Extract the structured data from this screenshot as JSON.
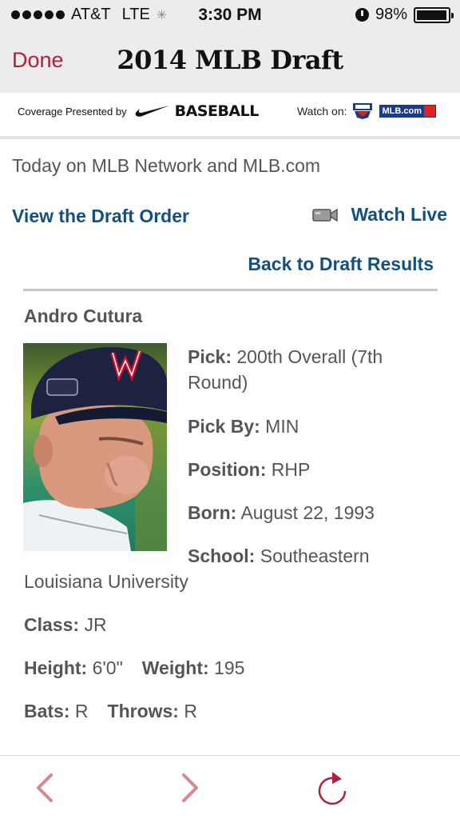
{
  "status_bar": {
    "carrier": "AT&T",
    "network": "LTE",
    "time": "3:30 PM",
    "battery": "98%",
    "battery_level": 0.98
  },
  "nav": {
    "done_label": "Done",
    "title": "2014 MLB Draft"
  },
  "sponsor": {
    "coverage_text": "Coverage Presented by",
    "brand_text": "BASEBALL",
    "watch_on": "Watch on:",
    "mlbcom": "MLB.com"
  },
  "main": {
    "today_text": "Today on MLB Network and MLB.com",
    "view_draft_order": "View the Draft Order",
    "watch_live": "Watch Live",
    "back_to_results": "Back to Draft Results"
  },
  "player": {
    "name": "Andro Cutura",
    "pick_label": "Pick:",
    "pick_value": "200th Overall (7th Round)",
    "pick_by_label": "Pick By:",
    "pick_by_value": "MIN",
    "position_label": "Position:",
    "position_value": "RHP",
    "born_label": "Born:",
    "born_value": "August 22, 1993",
    "school_label": "School:",
    "school_value_line1": "Southeastern",
    "school_value_line2": "Louisiana University",
    "class_label": "Class:",
    "class_value": "JR",
    "height_label": "Height:",
    "height_value": "6'0\"",
    "weight_label": "Weight:",
    "weight_value": "195",
    "bats_label": "Bats:",
    "bats_value": "R",
    "throws_label": "Throws:",
    "throws_value": "R"
  },
  "colors": {
    "accent_red": "#b1203a",
    "link_blue": "#14507f",
    "text_gray": "#555555"
  },
  "icons": {
    "back": "chevron-left-icon",
    "forward": "chevron-right-icon",
    "reload": "reload-icon",
    "camera": "video-camera-icon"
  }
}
